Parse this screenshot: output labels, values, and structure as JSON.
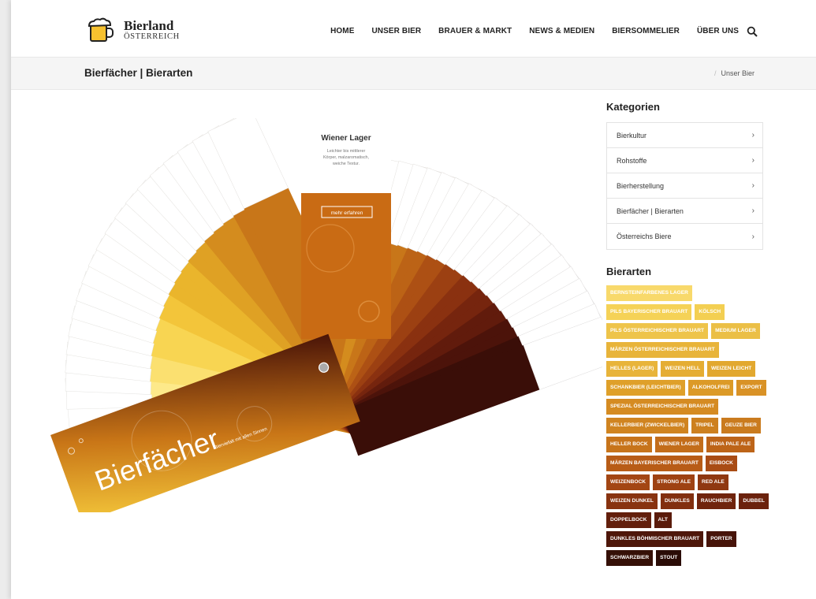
{
  "header": {
    "logo_title": "Bierland",
    "logo_subtitle": "ÖSTERREICH",
    "nav": [
      "HOME",
      "UNSER BIER",
      "BRAUER & MARKT",
      "NEWS & MEDIEN",
      "BIERSOMMELIER",
      "ÜBER UNS"
    ],
    "search_icon": "search-icon"
  },
  "titlebar": {
    "title": "Bierfächer | Bierarten",
    "breadcrumb": "Unser Bier"
  },
  "fan": {
    "card_title": "Wiener Lager",
    "card_text_1": "Leichter bis mittlerer",
    "card_text_2": "Körper, malzaromatisch,",
    "card_text_3": "weiche Textur.",
    "card_button": "mehr erfahren",
    "cover_title": "Bierfächer",
    "cover_subtitle": "Bierviefalt mit allen Sinnen",
    "colors": [
      "#fde98a",
      "#fbe070",
      "#f8d552",
      "#f3c53a",
      "#eab52c",
      "#dfa124",
      "#d48c1e",
      "#c87619",
      "#bc6316",
      "#ad5014",
      "#9c4012",
      "#8a3110",
      "#76250e",
      "#611b0c",
      "#4c130a",
      "#3a0e08"
    ]
  },
  "sidebar": {
    "categories_heading": "Kategorien",
    "categories": [
      "Bierkultur",
      "Rohstoffe",
      "Bierherstellung",
      "Bierfächer | Bierarten",
      "Österreichs Biere"
    ],
    "types_heading": "Bierarten",
    "types": [
      {
        "label": "Bernsteinfarbenes Lager",
        "color": "#f8d96b"
      },
      {
        "label": "Pils Bayerischer Brauart",
        "color": "#f5d257"
      },
      {
        "label": "Kölsch",
        "color": "#f3cf52"
      },
      {
        "label": "Pils Österreichischer Brauart",
        "color": "#eec44a"
      },
      {
        "label": "Medium Lager",
        "color": "#ebbf46"
      },
      {
        "label": "Märzen Österreichischer Brauart",
        "color": "#e8b43a"
      },
      {
        "label": "Helles (Lager)",
        "color": "#e8b43a"
      },
      {
        "label": "Weizen Hell",
        "color": "#e5ad33"
      },
      {
        "label": "Weizen Leicht",
        "color": "#e2a82f"
      },
      {
        "label": "Schankbier (Leichtbier)",
        "color": "#dfa02a"
      },
      {
        "label": "Alkoholfrei",
        "color": "#dc9a27"
      },
      {
        "label": "Export",
        "color": "#d99226"
      },
      {
        "label": "Spezial Österreichischer Brauart",
        "color": "#d58b22"
      },
      {
        "label": "Kellerbier (Zwickelbier)",
        "color": "#d08420"
      },
      {
        "label": "Tripel",
        "color": "#cd801f"
      },
      {
        "label": "Geuze Bier",
        "color": "#ca7b1e"
      },
      {
        "label": "Heller Bock",
        "color": "#c7741b"
      },
      {
        "label": "Wiener Lager",
        "color": "#c36d1a"
      },
      {
        "label": "India Pale Ale",
        "color": "#bd6418"
      },
      {
        "label": "Märzen Bayerischer Brauart",
        "color": "#b85c17"
      },
      {
        "label": "Eisbock",
        "color": "#a94c15"
      },
      {
        "label": "Weizenbock",
        "color": "#a34614"
      },
      {
        "label": "Strong Ale",
        "color": "#9e4213"
      },
      {
        "label": "Red Ale",
        "color": "#8f3811"
      },
      {
        "label": "Weizen Dunkel",
        "color": "#883310"
      },
      {
        "label": "Dunkles",
        "color": "#822f0f"
      },
      {
        "label": "Rauchbier",
        "color": "#70240d"
      },
      {
        "label": "Dubbel",
        "color": "#6b220d"
      },
      {
        "label": "Doppelbock",
        "color": "#631f0c"
      },
      {
        "label": "Alt",
        "color": "#5a1b0b"
      },
      {
        "label": "Dunkles Böhmischer Brauart",
        "color": "#4e170a"
      },
      {
        "label": "Porter",
        "color": "#471409"
      },
      {
        "label": "Schwarzbier",
        "color": "#351007"
      },
      {
        "label": "Stout",
        "color": "#2a0c06"
      }
    ]
  }
}
